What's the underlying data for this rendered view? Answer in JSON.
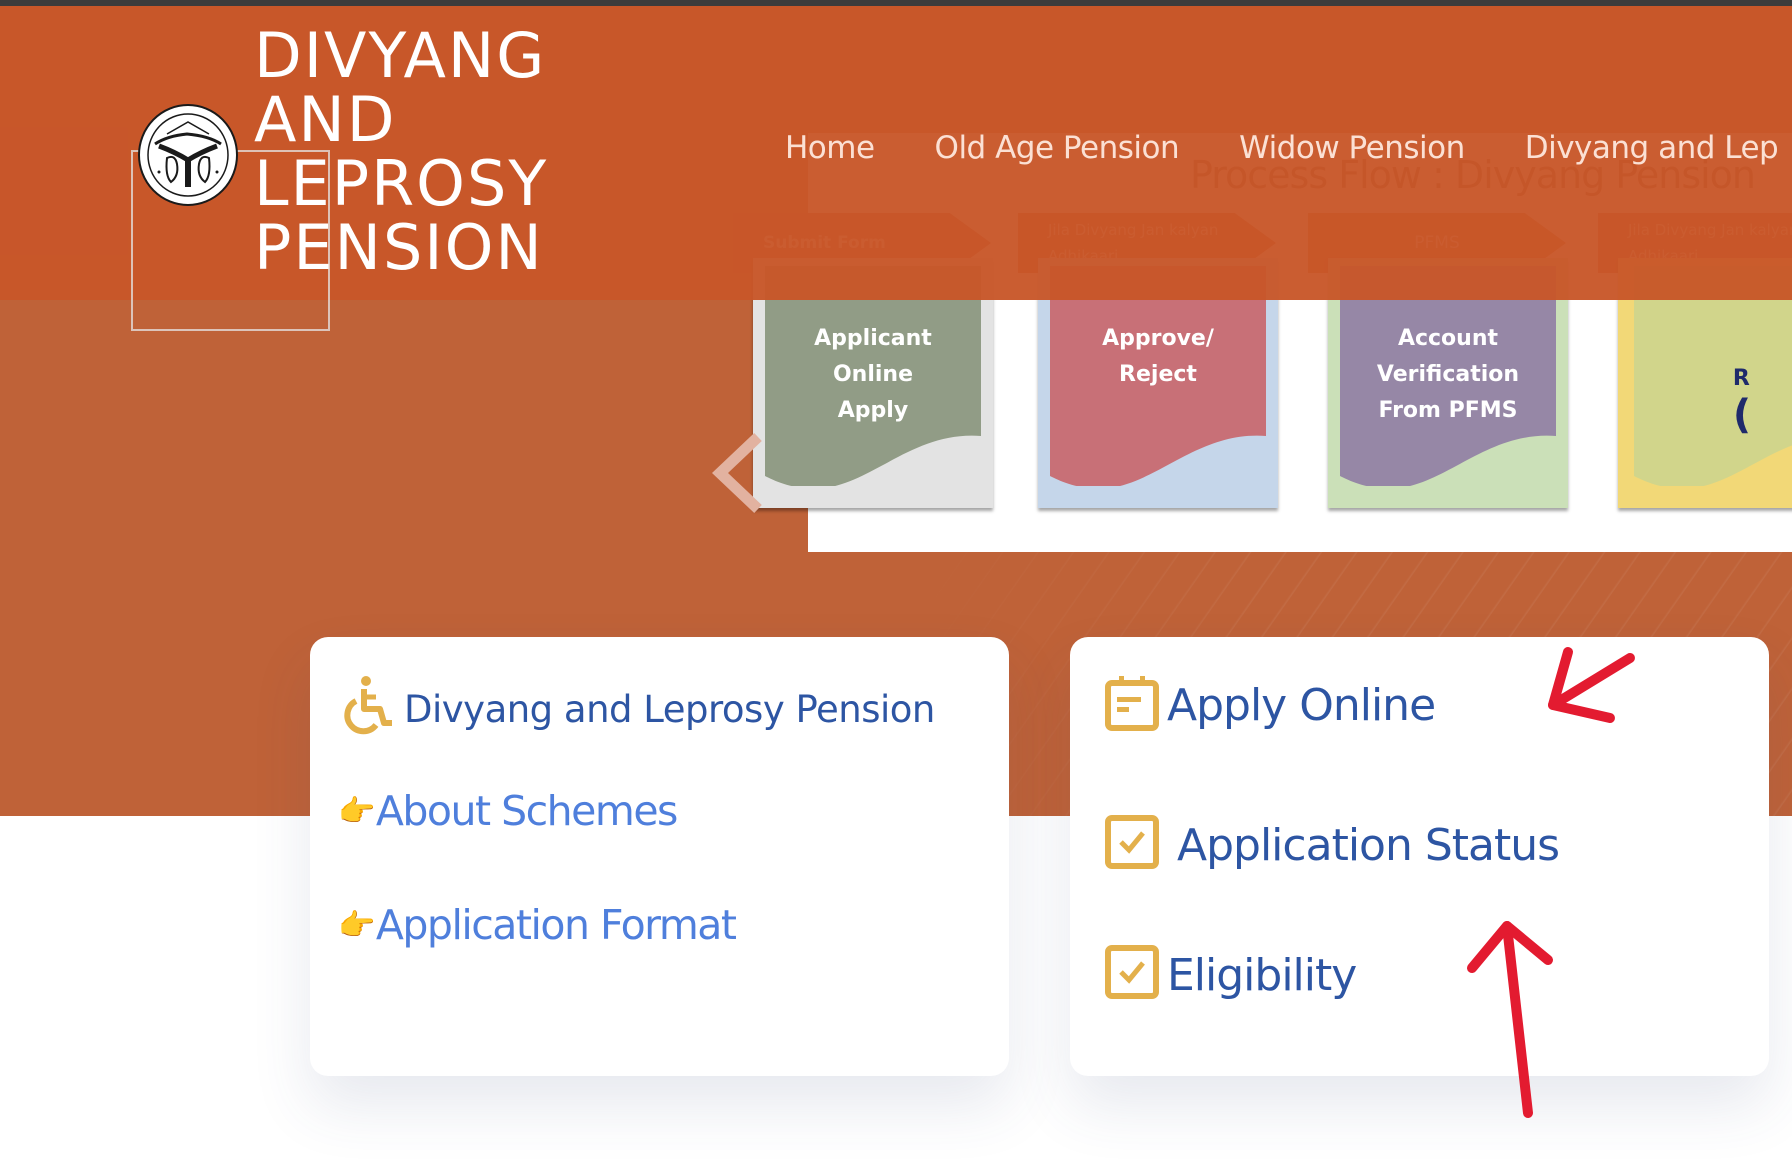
{
  "header": {
    "title_lines": [
      "DIVYANG",
      "AND",
      "LEPROSY",
      "PENSION"
    ],
    "emblem_icon": "uttar-pradesh-government-emblem",
    "nav": [
      {
        "label": "Home"
      },
      {
        "label": "Old Age Pension"
      },
      {
        "label": "Widow Pension"
      },
      {
        "label": "Divyang and Lep"
      }
    ]
  },
  "slider": {
    "title": "Process Flow : Divyang Pension",
    "prev_icon": "chevron-left-icon",
    "steps": [
      {
        "stage": "Submit Form",
        "action": [
          "Applicant",
          "Online",
          "Apply"
        ],
        "doc_color": "#919c86",
        "bg_color": "#e3e3e3"
      },
      {
        "stage": "Jila Divyang Jan kalyan Adhikaari",
        "action": [
          "Approve/",
          "Reject"
        ],
        "doc_color": "#c87077",
        "bg_color": "#c5d6ea"
      },
      {
        "stage": "PFMS",
        "action": [
          "Account",
          "Verification",
          "From PFMS"
        ],
        "doc_color": "#9687a6",
        "bg_color": "#cbe0b8"
      },
      {
        "stage": "Jila Divyang Jan kalyan Adhikaari",
        "action": [
          "R",
          "("
        ],
        "doc_color": "#d1d58b",
        "bg_color": "#f2d877"
      }
    ]
  },
  "left_card": {
    "heading": "Divyang and Leprosy Pension",
    "heading_icon": "wheelchair-icon",
    "links": [
      {
        "label": "About Schemes",
        "icon": "pointing-hand-icon"
      },
      {
        "label": "Application Format",
        "icon": "pointing-hand-icon"
      }
    ]
  },
  "right_card": {
    "items": [
      {
        "label": "Apply Online",
        "icon": "calendar-form-icon"
      },
      {
        "label": "Application Status",
        "icon": "checkbox-icon"
      },
      {
        "label": "Eligibility",
        "icon": "checkbox-icon"
      }
    ]
  },
  "colors": {
    "header_orange": "#c85629",
    "hero_orange": "#bf6238",
    "heading_blue": "#2d55a3",
    "link_blue": "#4f7fdc",
    "icon_gold": "#e3b04b",
    "annotation_red": "#e31b30"
  },
  "annotations": [
    {
      "type": "arrow",
      "points_to": "Apply Online"
    },
    {
      "type": "arrow",
      "points_to": "Application Status"
    }
  ]
}
